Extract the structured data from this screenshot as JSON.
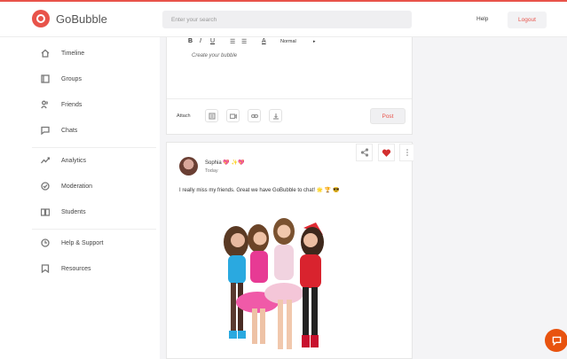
{
  "brand": {
    "name": "GoBubble",
    "accent": "#e8534a"
  },
  "search": {
    "placeholder": "Enter your search"
  },
  "header": {
    "help": "Help",
    "logout": "Logout"
  },
  "sidebar": {
    "items": [
      {
        "label": "Timeline",
        "icon": "home-icon"
      },
      {
        "label": "Groups",
        "icon": "groups-icon"
      },
      {
        "label": "Friends",
        "icon": "friends-icon"
      },
      {
        "label": "Chats",
        "icon": "chat-icon"
      },
      {
        "label": "Analytics",
        "icon": "analytics-icon"
      },
      {
        "label": "Moderation",
        "icon": "moderation-icon"
      },
      {
        "label": "Students",
        "icon": "students-icon"
      },
      {
        "label": "Help & Support",
        "icon": "help-icon"
      },
      {
        "label": "Resources",
        "icon": "resources-icon"
      }
    ]
  },
  "editor": {
    "toolbar": {
      "bold": "B",
      "italic": "I",
      "underline": "U",
      "ordered_list": "☰",
      "bullet_list": "☰",
      "font": "A",
      "style": "Normal",
      "dropdown": "▸"
    },
    "placeholder": "Create your bubble",
    "attach_label": "Attach",
    "post_label": "Post"
  },
  "post": {
    "author": "Sophia 💖 ✨💖",
    "time": "Today",
    "text": "I really miss my friends. Great we have GoBubble to chat! 🌟 🏆 😎"
  }
}
